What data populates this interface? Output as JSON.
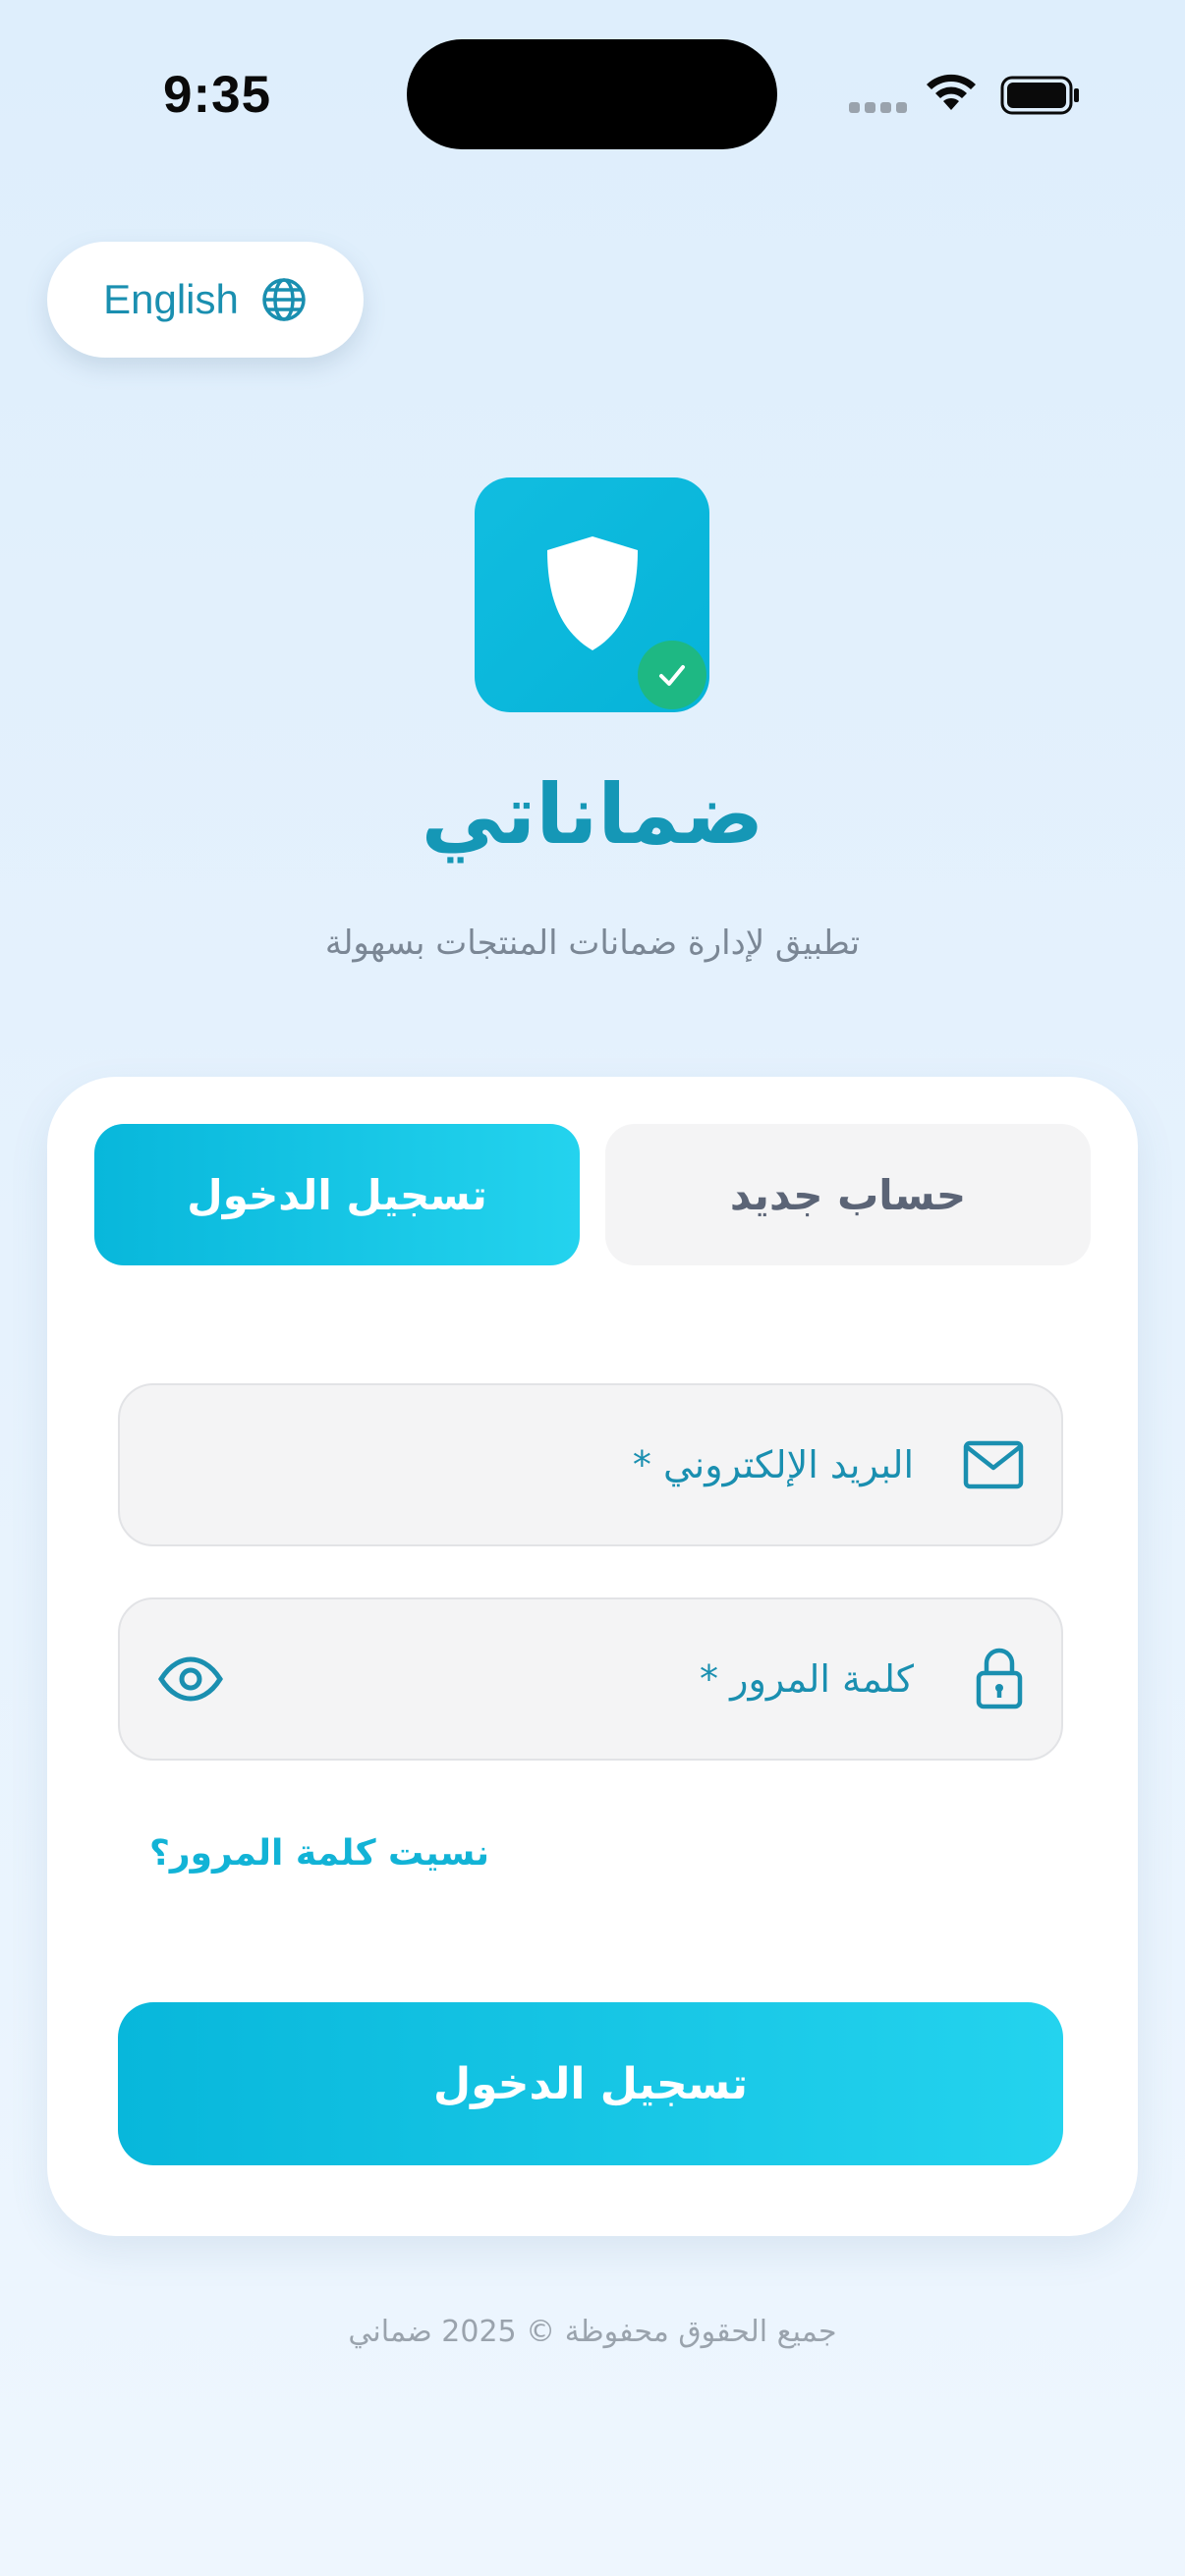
{
  "status_bar": {
    "time": "9:35"
  },
  "language_toggle": {
    "label": "English",
    "icon": "globe-icon"
  },
  "brand": {
    "app_name": "ضماناتي",
    "tagline": "تطبيق لإدارة ضمانات المنتجات بسهولة",
    "logo_icon": "shield-icon",
    "badge_icon": "check-icon"
  },
  "tabs": {
    "login": "تسجيل الدخول",
    "signup": "حساب جديد"
  },
  "form": {
    "email_label": "البريد الإلكتروني *",
    "email_icon": "mail-icon",
    "password_label": "كلمة المرور *",
    "password_icon": "lock-icon",
    "password_visibility_icon": "eye-icon",
    "forgot_password": "نسيت كلمة المرور؟",
    "submit": "تسجيل الدخول"
  },
  "footer": {
    "copyright": "جميع الحقوق محفوظة © 2025 ضماني"
  },
  "colors": {
    "accent": "#12b3d6",
    "accent_dark": "#1a8fb0",
    "success": "#1eb883",
    "background": "#e3f0fc"
  }
}
